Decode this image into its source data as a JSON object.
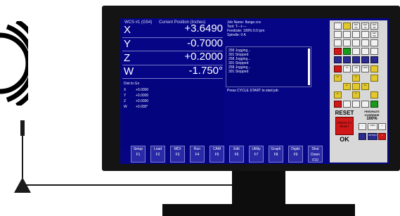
{
  "screen": {
    "header": {
      "wcs": "WCS #1 (G54)",
      "current_position": "Current Position (Inches)"
    },
    "axes": [
      {
        "label": "X",
        "value": "+3.6490"
      },
      {
        "label": "Y",
        "value": "-0.7000"
      },
      {
        "label": "Z",
        "value": "+0.2000"
      },
      {
        "label": "W",
        "value": "-1.750°"
      }
    ],
    "job_info": {
      "job_name": "Job Name: flange.cnc",
      "tool": "Tool:      T---t----",
      "feedrate": "Feedrate:  100%  0.0 ipm",
      "spindle": "Spindle:                0  A"
    },
    "log": [
      "258 Jogging...",
      "301 Stopped",
      "258 Jogging...",
      "301 Stopped",
      "258 Jogging...",
      "301 Stopped"
    ],
    "status": "Press CYCLE START to start job",
    "dist_to_go": {
      "title": "Dist to Go",
      "rows": [
        {
          "label": "X",
          "value": "+0.0000"
        },
        {
          "label": "Y",
          "value": "+0.0000"
        },
        {
          "label": "Z",
          "value": "+0.0000"
        },
        {
          "label": "W",
          "value": "+0.000°"
        }
      ]
    },
    "fkeys": [
      {
        "label": "Setup",
        "key": "F1"
      },
      {
        "label": "Load",
        "key": "F2"
      },
      {
        "label": "MDI",
        "key": "F3"
      },
      {
        "label": "Run",
        "key": "F4"
      },
      {
        "label": "CAM",
        "key": "F5"
      },
      {
        "label": "Edit",
        "key": "F6"
      },
      {
        "label": "Utility",
        "key": "F7"
      },
      {
        "label": "Graph",
        "key": "F8"
      },
      {
        "label": "Digitz",
        "key": "F9"
      },
      {
        "label": "Shut Down",
        "key": "F10"
      }
    ]
  },
  "panel": {
    "top_buttons": [
      "SET X0",
      "SET Y0",
      "SET Z0",
      "SET W0"
    ],
    "jog_labels": [
      "X+",
      "X-",
      "Y+",
      "Y-",
      "Z+",
      "Z-"
    ],
    "speed_labels": [
      "x1",
      "x10",
      "x100"
    ],
    "reset": {
      "label": "RESET",
      "press_text": "PRESS TO RESET"
    },
    "ok": "OK",
    "feedrate": {
      "title": "FEEDRATE OVERRIDE",
      "value": "100%",
      "pct": "100%"
    },
    "options": "OPTIONS",
    "colors": {
      "red": "#d01818",
      "green": "#1a9a1a",
      "yellow": "#e2c82a",
      "blue": "#050586"
    }
  }
}
